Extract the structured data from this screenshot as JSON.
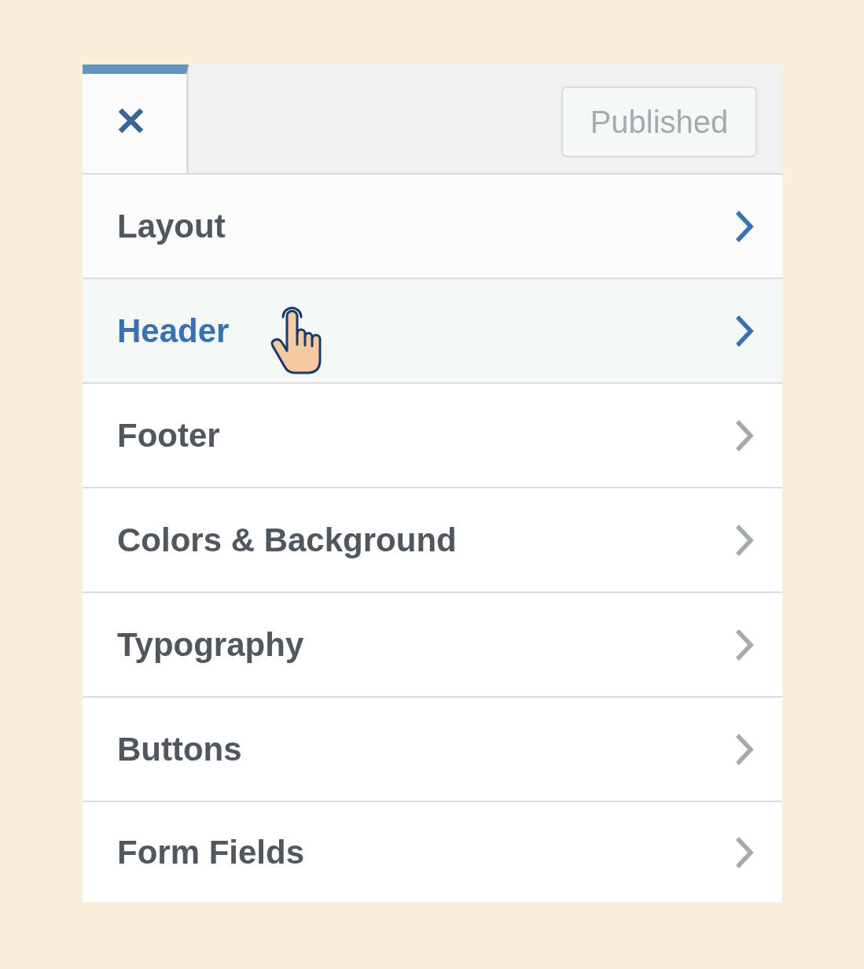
{
  "header": {
    "publish_button": {
      "label": "Published",
      "disabled": true
    }
  },
  "sections": [
    {
      "label": "Layout",
      "hovered": false,
      "focused": true
    },
    {
      "label": "Header",
      "hovered": true,
      "focused": false
    },
    {
      "label": "Footer",
      "hovered": false,
      "focused": false
    },
    {
      "label": "Colors & Background",
      "hovered": false,
      "focused": false
    },
    {
      "label": "Typography",
      "hovered": false,
      "focused": false
    },
    {
      "label": "Buttons",
      "hovered": false,
      "focused": false
    },
    {
      "label": "Form Fields",
      "hovered": false,
      "focused": false
    }
  ]
}
